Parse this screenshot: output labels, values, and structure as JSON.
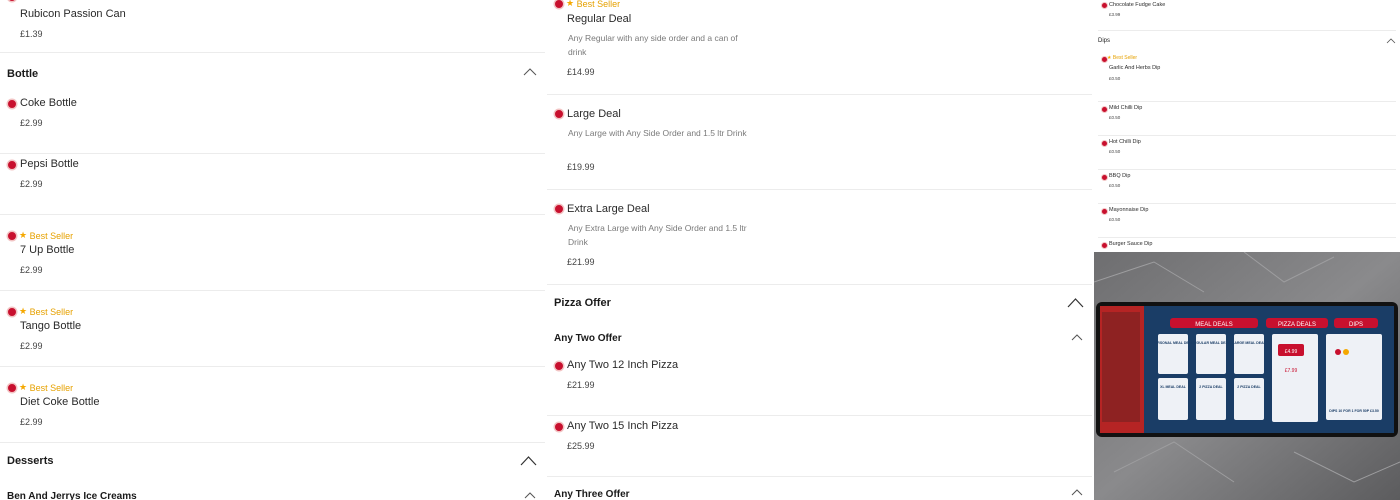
{
  "brand_colors": {
    "dot": "#c8102e",
    "best_seller": "#e6a100"
  },
  "best_seller_label": "Best Seller",
  "col1": {
    "top_item": {
      "name": "Rubicon Passion Can",
      "price": "£1.39"
    },
    "bottle_section": "Bottle",
    "bottles": [
      {
        "name": "Coke Bottle",
        "price": "£2.99",
        "best": false
      },
      {
        "name": "Pepsi Bottle",
        "price": "£2.99",
        "best": false
      },
      {
        "name": "7 Up Bottle",
        "price": "£2.99",
        "best": true
      },
      {
        "name": "Tango Bottle",
        "price": "£2.99",
        "best": true
      },
      {
        "name": "Diet Coke Bottle",
        "price": "£2.99",
        "best": true
      }
    ],
    "desserts_section": "Desserts",
    "ice_cream_sub": "Ben And Jerrys Ice Creams"
  },
  "col2": {
    "deals": [
      {
        "name": "Regular Deal",
        "desc": "Any Regular with any side order and a can of drink",
        "price": "£14.99",
        "best": true
      },
      {
        "name": "Large Deal",
        "desc": "Any Large with Any Side Order and 1.5 ltr Drink",
        "price": "£19.99",
        "best": false
      },
      {
        "name": "Extra Large Deal",
        "desc": "Any Extra Large with Any Side Order and 1.5 ltr Drink",
        "price": "£21.99",
        "best": false
      }
    ],
    "pizza_offer_section": "Pizza Offer",
    "any_two_sub": "Any Two Offer",
    "any_two_items": [
      {
        "name": "Any Two 12 Inch Pizza",
        "price": "£21.99"
      },
      {
        "name": "Any Two 15 Inch Pizza",
        "price": "£25.99"
      }
    ],
    "any_three_sub": "Any Three Offer"
  },
  "col3": {
    "top_item": {
      "name": "Chocolate Fudge Cake",
      "price": "£3.99"
    },
    "dips_section": "Dips",
    "dips": [
      {
        "name": "Garlic And Herbs Dip",
        "price": "£0.50",
        "best": true
      },
      {
        "name": "Mild Chilli Dip",
        "price": "£0.50",
        "best": false
      },
      {
        "name": "Hot Chilli Dip",
        "price": "£0.50",
        "best": false
      },
      {
        "name": "BBQ Dip",
        "price": "£0.50",
        "best": false
      },
      {
        "name": "Mayonnaise Dip",
        "price": "£0.50",
        "best": false
      },
      {
        "name": "Burger Sauce Dip",
        "price": "",
        "best": false
      }
    ],
    "photo_board": {
      "headers": [
        "MEAL DEALS",
        "PIZZA DEALS",
        "DIPS"
      ],
      "columns": [
        "PERSONAL MEAL DEAL",
        "REGULAR MEAL DEAL",
        "LARGE MEAL DEAL",
        "XL MEAL DEAL",
        "2 PIZZA DEAL",
        "2 PIZZA DEAL"
      ],
      "prices": [
        "£4.99",
        "£7.99"
      ],
      "dips_promo": "DIPS 10 FOR 1 FOR 50P £3.50"
    }
  }
}
